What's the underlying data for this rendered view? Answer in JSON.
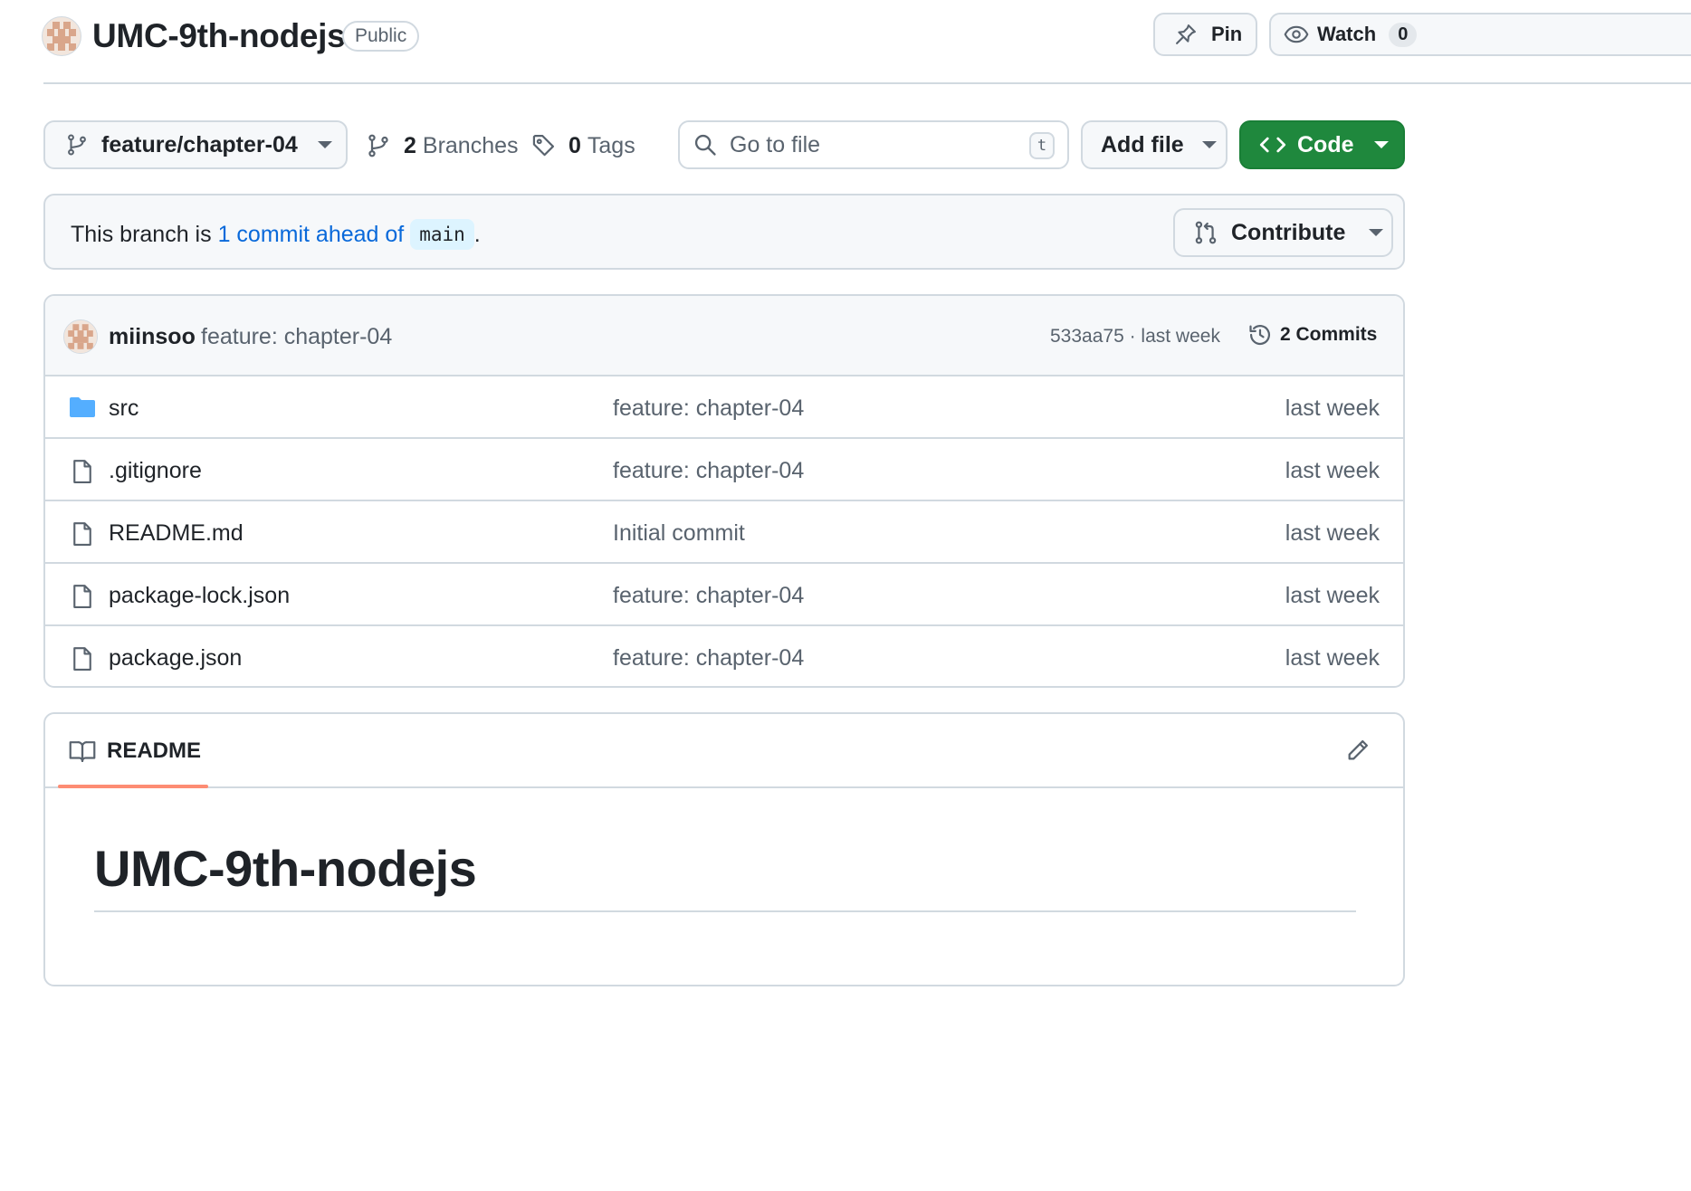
{
  "repo": {
    "name": "UMC-9th-nodejs",
    "visibility": "Public",
    "pin_label": "Pin",
    "watch_label": "Watch",
    "watch_count": "0"
  },
  "toolbar": {
    "branch": "feature/chapter-04",
    "branches_count": "2",
    "branches_label": "Branches",
    "tags_count": "0",
    "tags_label": "Tags",
    "search_placeholder": "Go to file",
    "search_shortcut": "t",
    "add_file_label": "Add file",
    "code_label": "Code",
    "code_color": "#1f883d"
  },
  "banner": {
    "prefix": "This branch is ",
    "link": "1 commit ahead of",
    "base_branch": "main",
    "suffix": ".",
    "contribute_label": "Contribute"
  },
  "latest_commit": {
    "author": "miinsoo",
    "message": "feature: chapter-04",
    "hash_time": "533aa75 · last week",
    "commits_label": "2 Commits"
  },
  "files": [
    {
      "name": "src",
      "type": "folder-icon",
      "message": "feature: chapter-04",
      "time": "last week"
    },
    {
      "name": ".gitignore",
      "type": "file-icon",
      "message": "feature: chapter-04",
      "time": "last week"
    },
    {
      "name": "README.md",
      "type": "file-icon",
      "message": "Initial commit",
      "time": "last week"
    },
    {
      "name": "package-lock.json",
      "type": "file-icon",
      "message": "feature: chapter-04",
      "time": "last week"
    },
    {
      "name": "package.json",
      "type": "file-icon",
      "message": "feature: chapter-04",
      "time": "last week"
    }
  ],
  "readme": {
    "tab_label": "README",
    "heading": "UMC-9th-nodejs"
  }
}
